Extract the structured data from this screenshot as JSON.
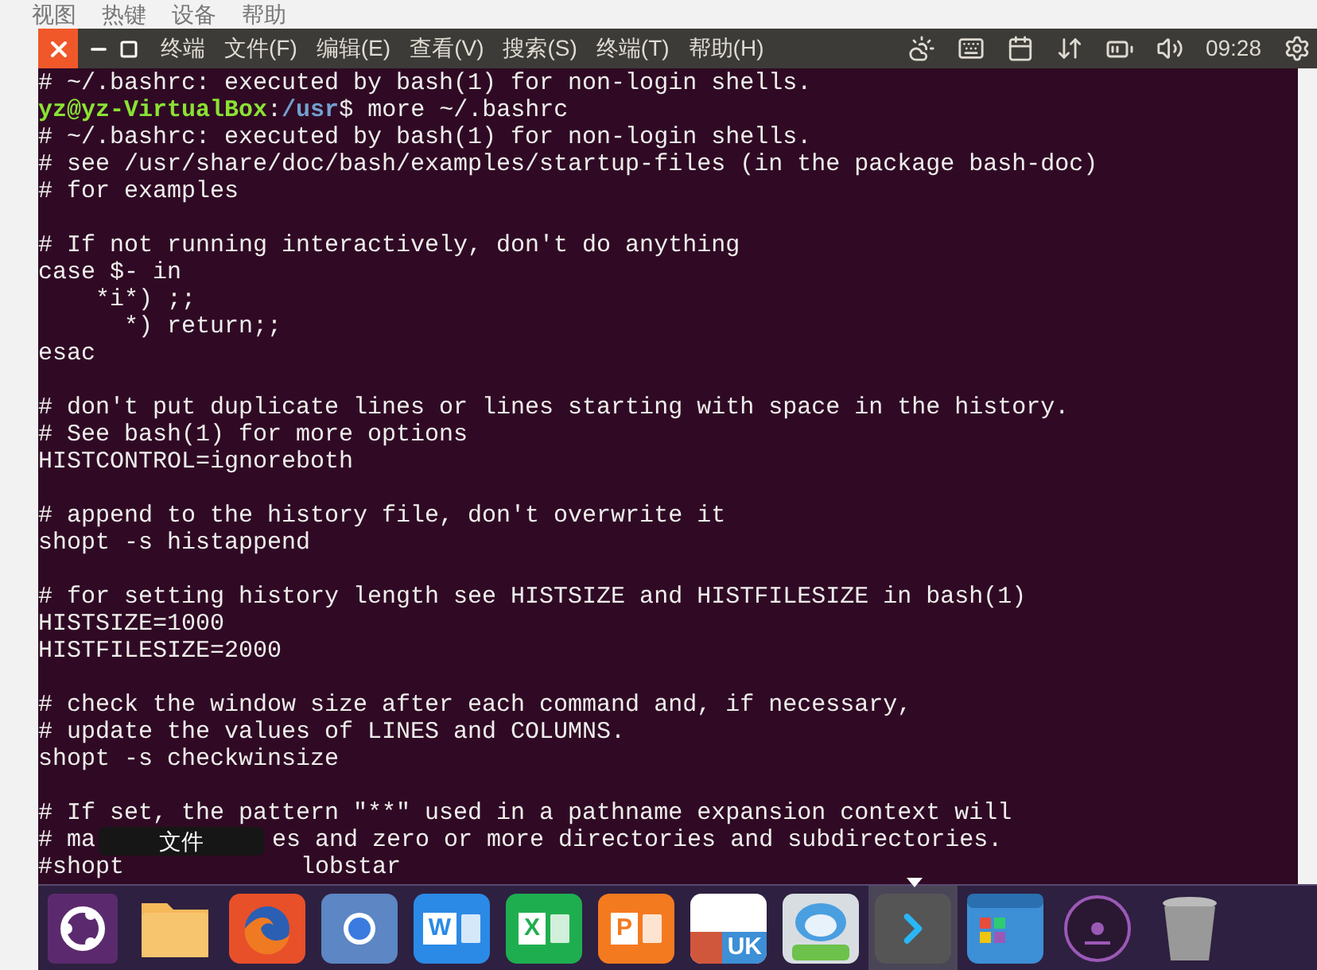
{
  "host_menu": [
    "视图",
    "热键",
    "设备",
    "帮助"
  ],
  "menu_bar": {
    "app_title": "终端",
    "menus": [
      "文件(F)",
      "编辑(E)",
      "查看(V)",
      "搜索(S)",
      "终端(T)",
      "帮助(H)"
    ],
    "time": "09:28"
  },
  "terminal": {
    "lines": [
      {
        "blank_before": false,
        "segments": [
          {
            "kind": "plain",
            "text": "# ~/.bashrc: executed by bash(1) for non-login shells."
          }
        ]
      },
      {
        "blank_before": false,
        "segments": [
          {
            "kind": "user",
            "text": "yz@yz-VirtualBox"
          },
          {
            "kind": "plain",
            "text": ":"
          },
          {
            "kind": "path",
            "text": "/usr"
          },
          {
            "kind": "plain",
            "text": "$ more ~/.bashrc"
          }
        ]
      },
      {
        "blank_before": false,
        "segments": [
          {
            "kind": "plain",
            "text": "# ~/.bashrc: executed by bash(1) for non-login shells."
          }
        ]
      },
      {
        "blank_before": false,
        "segments": [
          {
            "kind": "plain",
            "text": "# see /usr/share/doc/bash/examples/startup-files (in the package bash-doc)"
          }
        ]
      },
      {
        "blank_before": false,
        "segments": [
          {
            "kind": "plain",
            "text": "# for examples"
          }
        ]
      },
      {
        "blank_before": true,
        "segments": [
          {
            "kind": "plain",
            "text": "# If not running interactively, don't do anything"
          }
        ]
      },
      {
        "blank_before": false,
        "segments": [
          {
            "kind": "plain",
            "text": "case $- in"
          }
        ]
      },
      {
        "blank_before": false,
        "segments": [
          {
            "kind": "plain",
            "text": "    *i*) ;;"
          }
        ]
      },
      {
        "blank_before": false,
        "segments": [
          {
            "kind": "plain",
            "text": "      *) return;;"
          }
        ]
      },
      {
        "blank_before": false,
        "segments": [
          {
            "kind": "plain",
            "text": "esac"
          }
        ]
      },
      {
        "blank_before": true,
        "segments": [
          {
            "kind": "plain",
            "text": "# don't put duplicate lines or lines starting with space in the history."
          }
        ]
      },
      {
        "blank_before": false,
        "segments": [
          {
            "kind": "plain",
            "text": "# See bash(1) for more options"
          }
        ]
      },
      {
        "blank_before": false,
        "segments": [
          {
            "kind": "plain",
            "text": "HISTCONTROL=ignoreboth"
          }
        ]
      },
      {
        "blank_before": true,
        "segments": [
          {
            "kind": "plain",
            "text": "# append to the history file, don't overwrite it"
          }
        ]
      },
      {
        "blank_before": false,
        "segments": [
          {
            "kind": "plain",
            "text": "shopt -s histappend"
          }
        ]
      },
      {
        "blank_before": true,
        "segments": [
          {
            "kind": "plain",
            "text": "# for setting history length see HISTSIZE and HISTFILESIZE in bash(1)"
          }
        ]
      },
      {
        "blank_before": false,
        "segments": [
          {
            "kind": "plain",
            "text": "HISTSIZE=1000"
          }
        ]
      },
      {
        "blank_before": false,
        "segments": [
          {
            "kind": "plain",
            "text": "HISTFILESIZE=2000"
          }
        ]
      },
      {
        "blank_before": true,
        "segments": [
          {
            "kind": "plain",
            "text": "# check the window size after each command and, if necessary,"
          }
        ]
      },
      {
        "blank_before": false,
        "segments": [
          {
            "kind": "plain",
            "text": "# update the values of LINES and COLUMNS."
          }
        ]
      },
      {
        "blank_before": false,
        "segments": [
          {
            "kind": "plain",
            "text": "shopt -s checkwinsize"
          }
        ]
      },
      {
        "blank_before": true,
        "segments": [
          {
            "kind": "plain",
            "text": "# If set, the pattern \"**\" used in a pathname expansion context will"
          }
        ]
      },
      {
        "blank_before": false,
        "segments": [
          {
            "kind": "plain",
            "text": "# ma"
          },
          {
            "kind": "covered",
            "text": "es and zero or more directories and subdirectories."
          }
        ]
      },
      {
        "blank_before": false,
        "segments": [
          {
            "kind": "plain",
            "text": "#shopt"
          },
          {
            "kind": "covered",
            "text": "lobstar"
          }
        ]
      }
    ]
  },
  "tooltip": "文件",
  "dock": [
    {
      "kind": "ubuntu",
      "selected": false
    },
    {
      "kind": "folder",
      "selected": false
    },
    {
      "kind": "firefox",
      "selected": false
    },
    {
      "kind": "browser",
      "selected": false
    },
    {
      "kind": "doc",
      "label": "W",
      "color": "#2b8ae6",
      "selected": false
    },
    {
      "kind": "doc",
      "label": "X",
      "color": "#1fae4f",
      "selected": false
    },
    {
      "kind": "doc",
      "label": "P",
      "color": "#f47a20",
      "selected": false
    },
    {
      "kind": "bag",
      "label": "UK",
      "selected": false
    },
    {
      "kind": "robot",
      "selected": false
    },
    {
      "kind": "terminal",
      "selected": true
    },
    {
      "kind": "apps",
      "selected": false
    },
    {
      "kind": "disc",
      "selected": false
    },
    {
      "kind": "trash",
      "selected": false
    }
  ]
}
